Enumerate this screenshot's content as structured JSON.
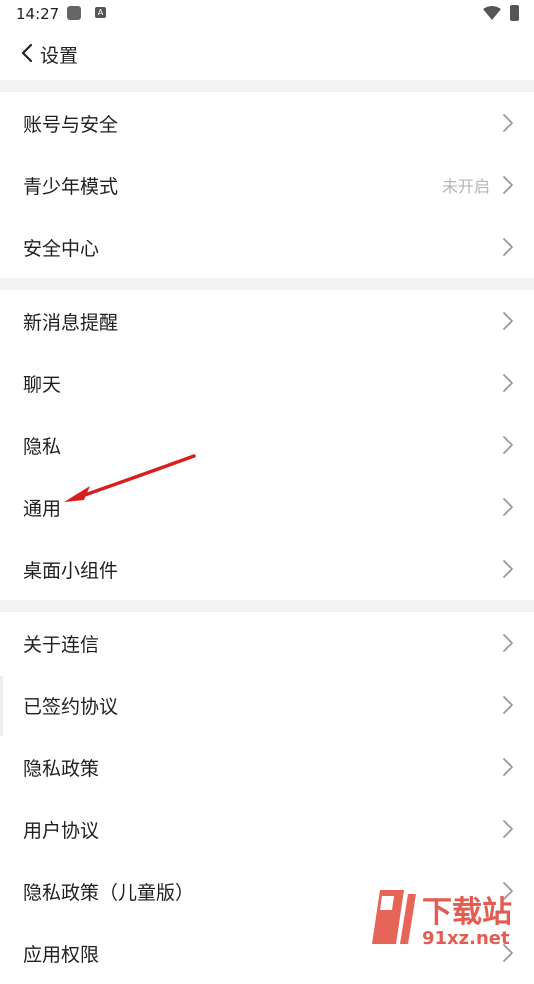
{
  "status_bar": {
    "time": "14:27",
    "icons": [
      "square-icon",
      "a-icon",
      "wifi-icon",
      "battery-icon"
    ]
  },
  "header": {
    "title": "设置",
    "back_icon": "chevron-left-icon"
  },
  "groups": [
    {
      "items": [
        {
          "label": "账号与安全",
          "value": ""
        },
        {
          "label": "青少年模式",
          "value": "未开启"
        },
        {
          "label": "安全中心",
          "value": ""
        }
      ]
    },
    {
      "items": [
        {
          "label": "新消息提醒",
          "value": ""
        },
        {
          "label": "聊天",
          "value": ""
        },
        {
          "label": "隐私",
          "value": ""
        },
        {
          "label": "通用",
          "value": ""
        },
        {
          "label": "桌面小组件",
          "value": ""
        }
      ]
    },
    {
      "items": [
        {
          "label": "关于连信",
          "value": ""
        },
        {
          "label": "已签约协议",
          "value": ""
        },
        {
          "label": "隐私政策",
          "value": ""
        },
        {
          "label": "用户协议",
          "value": ""
        },
        {
          "label": "隐私政策（儿童版）",
          "value": ""
        },
        {
          "label": "应用权限",
          "value": ""
        }
      ]
    }
  ],
  "watermark": {
    "brand": "下载站",
    "domain": "91xz.net"
  },
  "colors": {
    "background": "#ffffff",
    "divider": "#f3f3f3",
    "chevron": "#9a9a9a",
    "arrow": "#d81e1e"
  }
}
